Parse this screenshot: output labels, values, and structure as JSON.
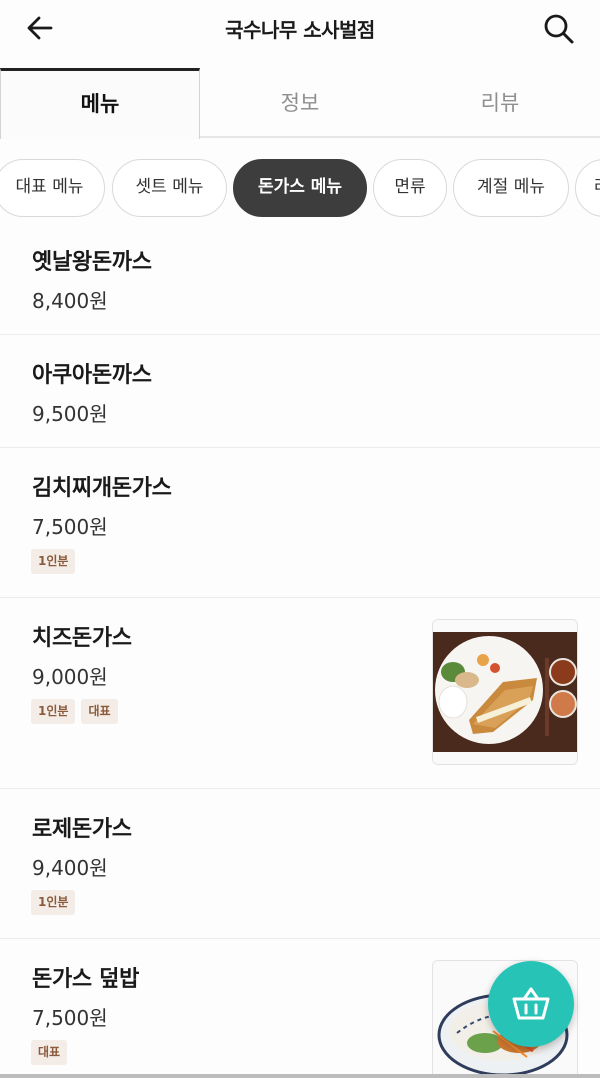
{
  "header": {
    "title": "국수나무 소사벌점"
  },
  "tabs": [
    {
      "label": "메뉴",
      "active": true
    },
    {
      "label": "정보",
      "active": false
    },
    {
      "label": "리뷰",
      "active": false
    }
  ],
  "categories": [
    {
      "label": "대표 메뉴"
    },
    {
      "label": "셋트 메뉴"
    },
    {
      "label": "돈가스 메뉴",
      "active": true
    },
    {
      "label": "면류"
    },
    {
      "label": "계절 메뉴"
    },
    {
      "label": "라"
    }
  ],
  "menu": {
    "items": [
      {
        "name": "옛날왕돈까스",
        "price": "8,400원"
      },
      {
        "name": "아쿠아돈까스",
        "price": "9,500원"
      },
      {
        "name": "김치찌개돈가스",
        "price": "7,500원",
        "badges": [
          "1인분"
        ]
      },
      {
        "name": "치즈돈가스",
        "price": "9,000원",
        "badges": [
          "1인분",
          "대표"
        ],
        "image": "cutlet-plate"
      },
      {
        "name": "로제돈가스",
        "price": "9,400원",
        "badges": [
          "1인분"
        ]
      },
      {
        "name": "돈가스 덮밥",
        "price": "7,500원",
        "badges": [
          "대표"
        ],
        "image": "rice-bowl"
      }
    ]
  },
  "icons": {
    "back": "arrow-left-icon",
    "search": "search-icon",
    "cart": "basket-icon"
  },
  "colors": {
    "accent": "#27c3b7",
    "chip_active": "#3d3d3d",
    "badge_bg": "#f4ece6",
    "badge_text": "#8a5a3c"
  }
}
